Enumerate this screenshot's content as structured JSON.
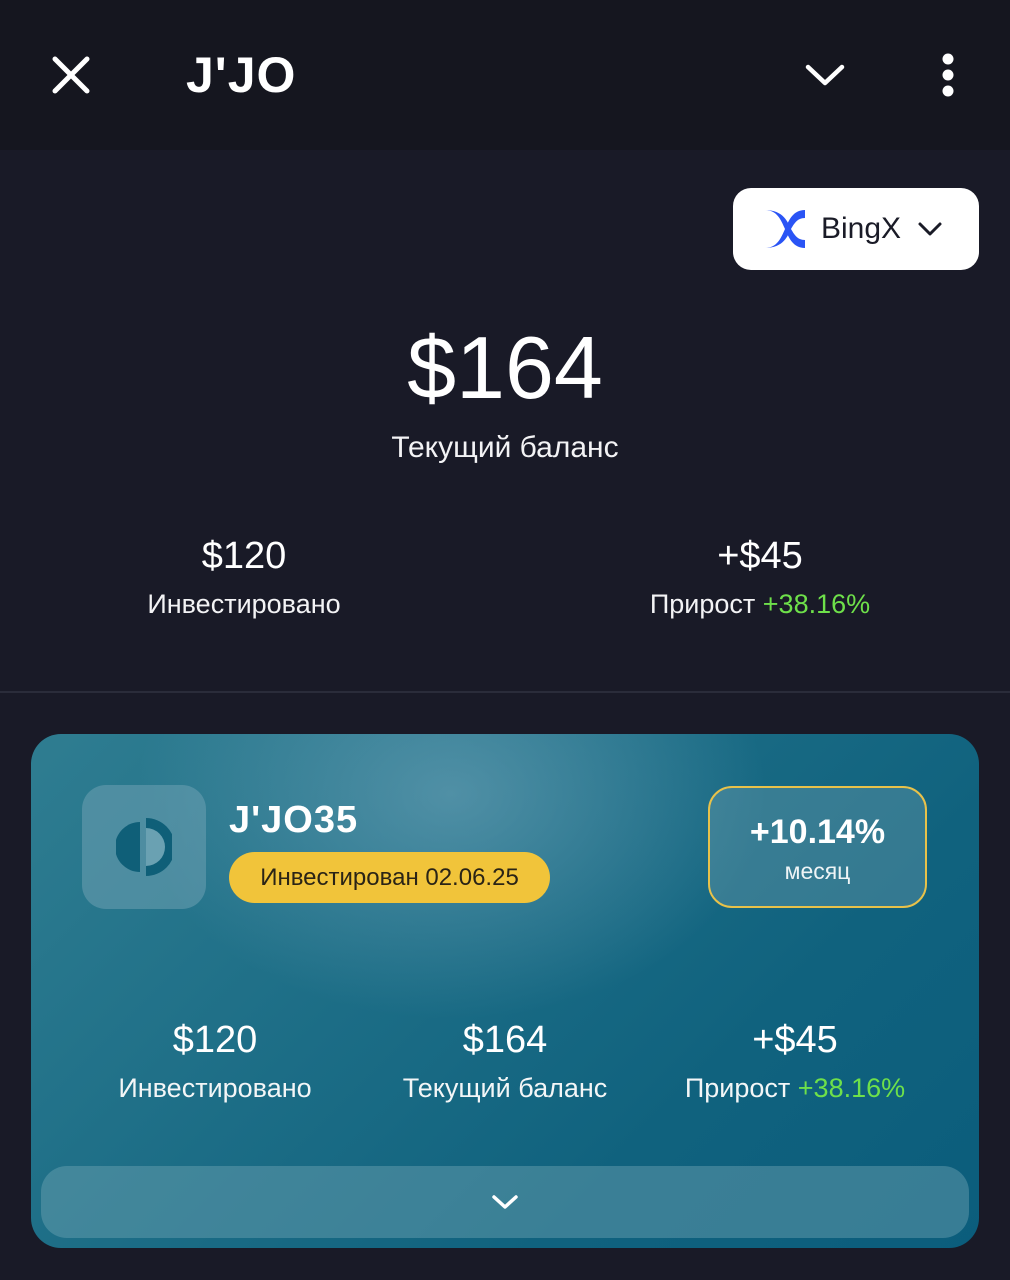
{
  "header": {
    "title": "J'JO"
  },
  "exchange": {
    "name": "BingX"
  },
  "summary": {
    "balance": "$164",
    "balance_label": "Текущий баланс",
    "invested_value": "$120",
    "invested_label": "Инвестировано",
    "growth_value": "+$45",
    "growth_label": "Прирост",
    "growth_pct": "+38.16%"
  },
  "fund": {
    "name": "J'JO35",
    "invested_badge": "Инвестирован 02.06.25",
    "monthly_pct": "+10.14%",
    "monthly_label": "месяц",
    "invested_value": "$120",
    "invested_label": "Инвестировано",
    "balance_value": "$164",
    "balance_label": "Текущий баланс",
    "growth_value": "+$45",
    "growth_label": "Прирост",
    "growth_pct": "+38.16%"
  },
  "icons": {
    "close": "close-icon",
    "chevron": "chevron-down-icon",
    "more": "more-vertical-icon",
    "exchange_logo": "bingx-logo-icon",
    "fund_logo": "fund-logo-icon"
  },
  "colors": {
    "background": "#191a27",
    "header": "#15161f",
    "accent_green": "#6ee04a",
    "badge_yellow": "#f1c43a",
    "card_teal": "#1c6d86"
  }
}
